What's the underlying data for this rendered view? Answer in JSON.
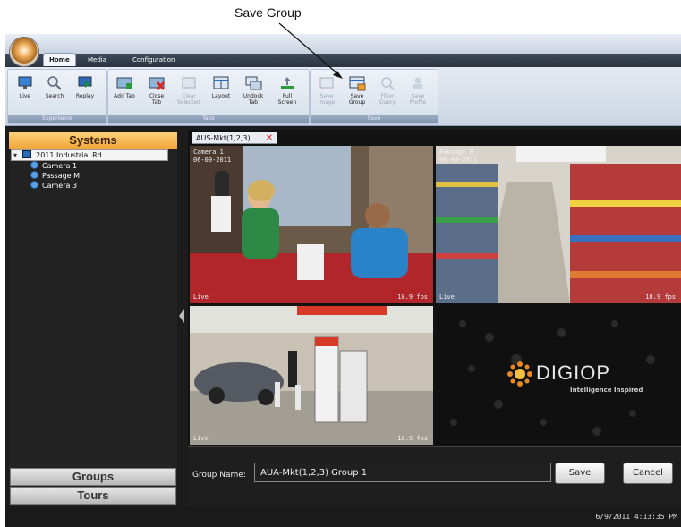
{
  "annotation": {
    "label": "Save Group"
  },
  "ribbon_tabs": [
    "Home",
    "Media",
    "Configuration"
  ],
  "ribbon_groups": {
    "experience": {
      "caption": "Experience",
      "buttons": [
        {
          "label": "Live",
          "icon": "live-icon"
        },
        {
          "label": "Search",
          "icon": "search-icon"
        },
        {
          "label": "Replay",
          "icon": "replay-icon"
        }
      ]
    },
    "tabs": {
      "caption": "Tabs",
      "buttons": [
        {
          "label": "Add Tab",
          "icon": "add-tab-icon"
        },
        {
          "label": "Close Tab",
          "icon": "close-tab-icon"
        },
        {
          "label": "Clear Selected",
          "icon": "clear-selected-icon",
          "disabled": true
        },
        {
          "label": "Layout",
          "icon": "layout-icon"
        },
        {
          "label": "Undock Tab",
          "icon": "undock-tab-icon"
        },
        {
          "label": "Full Screen",
          "icon": "full-screen-icon"
        }
      ]
    },
    "save": {
      "caption": "Save",
      "buttons": [
        {
          "label": "Save Image",
          "icon": "save-image-icon",
          "disabled": true
        },
        {
          "label": "Save Group",
          "icon": "save-group-icon"
        },
        {
          "label": "Filter Query",
          "icon": "filter-query-icon",
          "disabled": true
        },
        {
          "label": "Save Profile",
          "icon": "save-profile-icon",
          "disabled": true
        }
      ]
    }
  },
  "sidebar": {
    "header": "Systems",
    "tree": {
      "root": "2011 Industrial Rd",
      "cameras": [
        "Camera 1",
        "Passage M",
        "Camera 3"
      ]
    },
    "groups_label": "Groups",
    "tours_label": "Tours"
  },
  "view": {
    "tab_label": "AUS-Mkt(1,2,3)",
    "tiles": [
      {
        "title": "Camera 1",
        "date": "06-09-2011",
        "fps": "18.9 fps",
        "mode": "Live"
      },
      {
        "title": "Passage M",
        "date": "06-09-2011",
        "fps": "18.9 fps",
        "mode": "Live"
      },
      {
        "title": "",
        "date": "",
        "fps": "18.9 fps",
        "mode": "Live"
      },
      {
        "brand": "DIGIOP",
        "tagline": "Intelligence Inspired"
      }
    ]
  },
  "group_bar": {
    "label": "Group Name:",
    "value": "AUA-Mkt(1,2,3) Group 1",
    "save": "Save",
    "cancel": "Cancel"
  },
  "status": {
    "timestamp": "6/9/2011 4:13:35 PM"
  },
  "colors": {
    "accent": "#f2a63a",
    "ribbon": "#d6dfea",
    "close_x": "#dd2222"
  }
}
